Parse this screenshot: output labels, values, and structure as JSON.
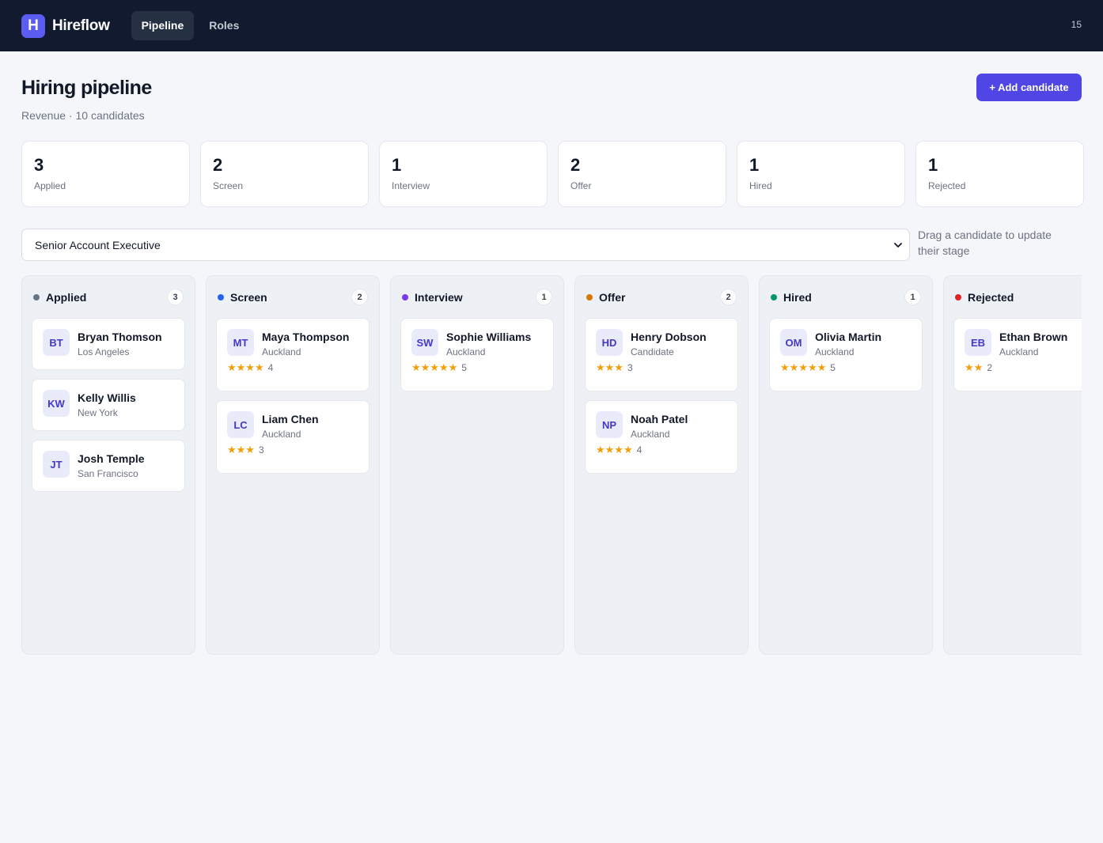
{
  "app": {
    "logo_letter": "H",
    "name": "Hireflow",
    "nav": [
      {
        "label": "Pipeline",
        "active": true
      },
      {
        "label": "Roles",
        "active": false
      }
    ],
    "top_count": "15"
  },
  "header": {
    "title": "Hiring pipeline",
    "subtitle": "Revenue · 10 candidates",
    "add_button": "+ Add candidate"
  },
  "stats": [
    {
      "value": "3",
      "label": "Applied"
    },
    {
      "value": "2",
      "label": "Screen"
    },
    {
      "value": "1",
      "label": "Interview"
    },
    {
      "value": "2",
      "label": "Offer"
    },
    {
      "value": "1",
      "label": "Hired"
    },
    {
      "value": "1",
      "label": "Rejected"
    }
  ],
  "filter": {
    "role_selected": "Senior Account Executive",
    "hint": "Drag a candidate to update their stage"
  },
  "columns": [
    {
      "title": "Applied",
      "count": "3",
      "color": "#64748b",
      "cards": [
        {
          "initials": "BT",
          "name": "Bryan Thomson",
          "location": "Los Angeles"
        },
        {
          "initials": "KW",
          "name": "Kelly Willis",
          "location": "New York"
        },
        {
          "initials": "JT",
          "name": "Josh Temple",
          "location": "San Francisco"
        }
      ]
    },
    {
      "title": "Screen",
      "count": "2",
      "color": "#2563eb",
      "cards": [
        {
          "initials": "MT",
          "name": "Maya Thompson",
          "location": "Auckland",
          "rating": 4,
          "rating_text": "4"
        },
        {
          "initials": "LC",
          "name": "Liam Chen",
          "location": "Auckland",
          "rating": 3,
          "rating_text": "3"
        }
      ]
    },
    {
      "title": "Interview",
      "count": "1",
      "color": "#7c3aed",
      "cards": [
        {
          "initials": "SW",
          "name": "Sophie Williams",
          "location": "Auckland",
          "rating": 5,
          "rating_text": "5"
        }
      ]
    },
    {
      "title": "Offer",
      "count": "2",
      "color": "#d97706",
      "cards": [
        {
          "initials": "HD",
          "name": "Henry Dobson",
          "location": "Candidate",
          "rating": 3,
          "rating_text": "3"
        },
        {
          "initials": "NP",
          "name": "Noah Patel",
          "location": "Auckland",
          "rating": 4,
          "rating_text": "4"
        }
      ]
    },
    {
      "title": "Hired",
      "count": "1",
      "color": "#059669",
      "cards": [
        {
          "initials": "OM",
          "name": "Olivia Martin",
          "location": "Auckland",
          "rating": 5,
          "rating_text": "5"
        }
      ]
    },
    {
      "title": "Rejected",
      "count": "",
      "color": "#dc2626",
      "cards": [
        {
          "initials": "EB",
          "name": "Ethan Brown",
          "location": "Auckland",
          "rating": 2,
          "rating_text": "2"
        }
      ]
    }
  ]
}
